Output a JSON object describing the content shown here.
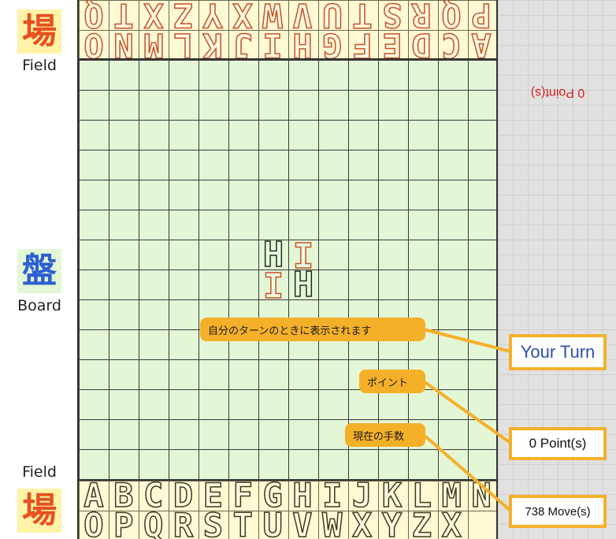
{
  "legend": {
    "field_top_kanji": "場",
    "field_top_caption": "Field",
    "board_kanji": "盤",
    "board_caption": "Board",
    "field_bottom_caption": "Field",
    "field_bottom_kanji": "場"
  },
  "opponent_field": {
    "row1": [
      "A",
      "C",
      "D",
      "E",
      "F",
      "G",
      "H",
      "I",
      "J",
      "K",
      "L",
      "M",
      "N",
      "O"
    ],
    "row2": [
      "P",
      "Q",
      "R",
      "S",
      "T",
      "U",
      "V",
      "W",
      "X",
      "Y",
      "Z",
      "X",
      "T",
      "Q"
    ]
  },
  "player_field": {
    "row1": [
      "A",
      "B",
      "C",
      "D",
      "E",
      "F",
      "G",
      "H",
      "I",
      "J",
      "K",
      "L",
      "M",
      "N"
    ],
    "row2": [
      "O",
      "P",
      "Q",
      "R",
      "S",
      "T",
      "U",
      "V",
      "W",
      "X",
      "Y",
      "Z",
      "X",
      ""
    ]
  },
  "board_pieces": [
    {
      "letter": "H",
      "owner": "mine"
    },
    {
      "letter": "I",
      "owner": "theirs"
    },
    {
      "letter": "I",
      "owner": "theirs"
    },
    {
      "letter": "H",
      "owner": "mine"
    }
  ],
  "opponent_points": "0 Point(s)",
  "status": {
    "turn": "Your Turn",
    "points": "0 Point(s)",
    "moves": "738 Move(s)"
  },
  "callouts": {
    "turn": "自分のターンのときに表示されます",
    "points": "ポイント",
    "moves": "現在の手数"
  },
  "colors": {
    "accent": "#f5b02a",
    "opponent": "#c8502a",
    "player": "#1e2a1e",
    "board": "#e3f6d6",
    "field": "#fff9d4"
  }
}
